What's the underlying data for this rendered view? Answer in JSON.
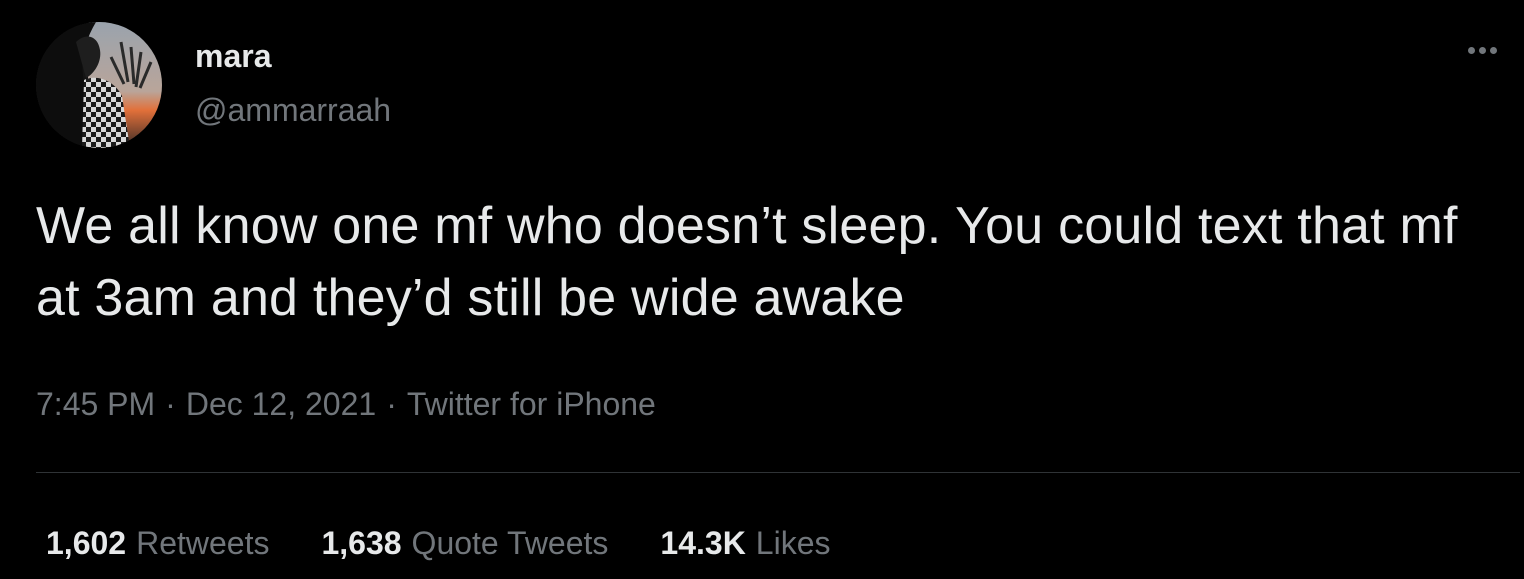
{
  "author": {
    "display_name": "mara",
    "handle": "@ammarraah"
  },
  "tweet": {
    "text": "We all know one mf who doesn’t sleep. You could text that mf at 3am and they’d still be wide awake",
    "time": "7:45 PM",
    "date": "Dec 12, 2021",
    "source": "Twitter for iPhone",
    "separator": "·"
  },
  "stats": {
    "retweets": {
      "count": "1,602",
      "label": "Retweets"
    },
    "quote_tweets": {
      "count": "1,638",
      "label": "Quote Tweets"
    },
    "likes": {
      "count": "14.3K",
      "label": "Likes"
    }
  },
  "icons": {
    "more": "more-horizontal-icon"
  },
  "colors": {
    "background": "#000000",
    "primary_text": "#e7e9ea",
    "secondary_text": "#71767b",
    "divider": "#2f3336"
  }
}
